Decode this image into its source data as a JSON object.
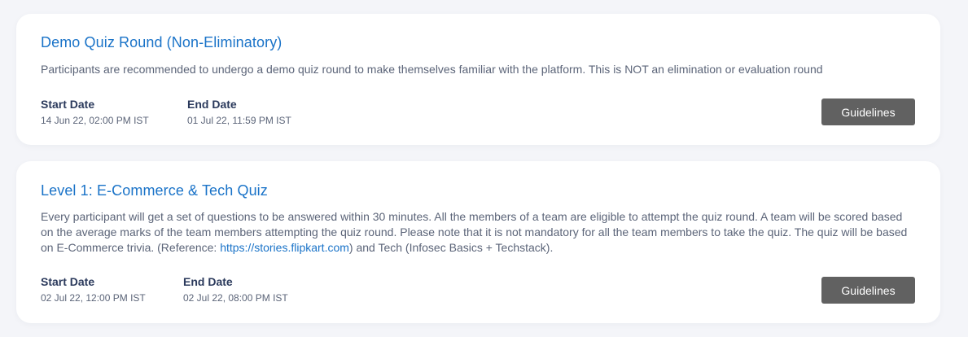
{
  "rounds": [
    {
      "title": "Demo Quiz Round (Non-Eliminatory)",
      "description": "Participants are recommended to undergo a demo quiz round to make themselves familiar with the platform. This is NOT an elimination or evaluation round",
      "start_label": "Start Date",
      "start_value": "14 Jun 22, 02:00 PM IST",
      "end_label": "End Date",
      "end_value": "01 Jul 22, 11:59 PM IST",
      "button_label": "Guidelines"
    },
    {
      "title": "Level 1: E-Commerce & Tech Quiz",
      "description_before_link": "Every participant will get a set of questions to be answered within 30 minutes. All the members of a team are eligible to attempt the quiz round. A team will be scored based on the average marks of the team members attempting the quiz round. Please note that it is not mandatory for all the team members to take the quiz. The quiz will be based on E-Commerce trivia. (Reference: ",
      "description_link": "https://stories.flipkart.com",
      "description_after_link": ") and Tech (Infosec Basics + Techstack).",
      "start_label": "Start Date",
      "start_value": "02 Jul 22, 12:00 PM IST",
      "end_label": "End Date",
      "end_value": "02 Jul 22, 08:00 PM IST",
      "button_label": "Guidelines"
    }
  ],
  "colors": {
    "accent": "#1a73c8",
    "button_bg": "#616161",
    "page_bg": "#f4f5f9"
  }
}
